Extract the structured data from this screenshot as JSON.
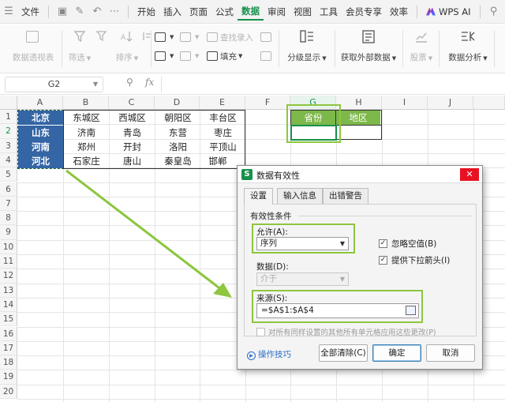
{
  "menubar": {
    "items": [
      "文件",
      "开始",
      "插入",
      "页面",
      "公式",
      "数据",
      "审阅",
      "视图",
      "工具",
      "会员专享",
      "效率"
    ],
    "active": "数据",
    "wps_ai": "WPS AI"
  },
  "ribbon": {
    "pivot": "数据透视表",
    "filter": "筛选",
    "sort": "排序",
    "find_input": "查找录入",
    "fill": "填充",
    "group_display": "分级显示",
    "external_data": "获取外部数据",
    "stocks": "股票",
    "data_analysis": "数据分析"
  },
  "formula_bar": {
    "name_box": "G2",
    "fx": "fx",
    "formula": ""
  },
  "sheet": {
    "columns": [
      "A",
      "B",
      "C",
      "D",
      "E",
      "F",
      "G",
      "H",
      "I",
      "J"
    ],
    "rows": [
      "1",
      "2",
      "3",
      "4",
      "5",
      "6",
      "7",
      "8",
      "9",
      "10",
      "11",
      "12",
      "13",
      "14",
      "15",
      "16",
      "17",
      "18",
      "19",
      "20"
    ],
    "provinces": [
      "北京",
      "山东",
      "河南",
      "河北"
    ],
    "districts": [
      [
        "东城区",
        "西城区",
        "朝阳区",
        "丰台区"
      ],
      [
        "济南",
        "青岛",
        "东营",
        "枣庄"
      ],
      [
        "郑州",
        "开封",
        "洛阳",
        "平顶山"
      ],
      [
        "石家庄",
        "唐山",
        "秦皇岛",
        "邯郸"
      ]
    ],
    "g1": "省份",
    "h1": "地区"
  },
  "dialog": {
    "title": "数据有效性",
    "tabs": [
      "设置",
      "输入信息",
      "出错警告"
    ],
    "section": "有效性条件",
    "allow_label": "允许(A):",
    "allow_value": "序列",
    "ignore_blank": "忽略空值(B)",
    "dropdown_arrow": "提供下拉箭头(I)",
    "data_label": "数据(D):",
    "data_value": "介于",
    "source_label": "来源(S):",
    "source_value": "=$A$1:$A$4",
    "apply_all": "对所有同样设置的其他所有单元格应用这些更改(P)",
    "tips": "操作技巧",
    "clear_all": "全部清除(C)",
    "ok": "确定",
    "cancel": "取消",
    "app_icon": "S"
  }
}
